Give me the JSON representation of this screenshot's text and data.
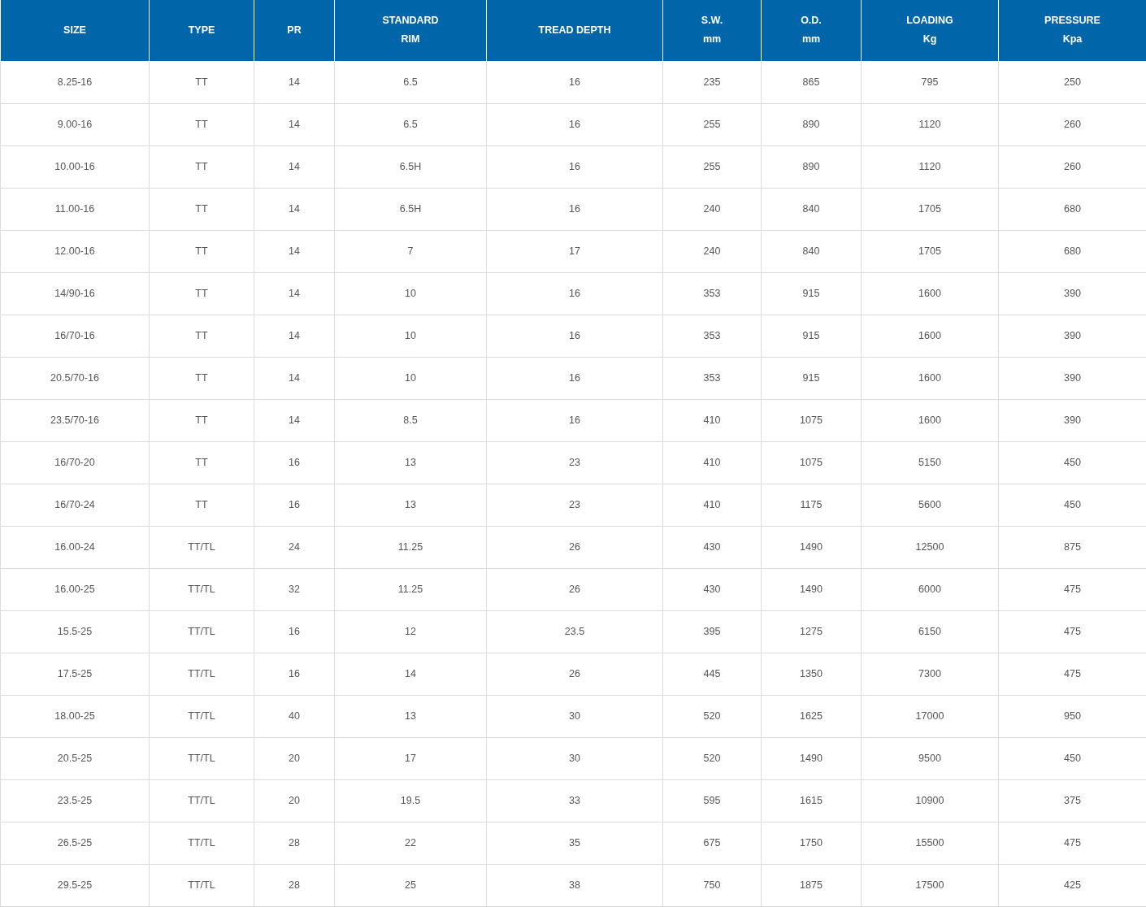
{
  "table": {
    "columns": [
      {
        "lines": [
          "SIZE"
        ]
      },
      {
        "lines": [
          "TYPE"
        ]
      },
      {
        "lines": [
          "PR"
        ]
      },
      {
        "lines": [
          "STANDARD",
          "RIM"
        ]
      },
      {
        "lines": [
          "TREAD DEPTH"
        ]
      },
      {
        "lines": [
          "S.W.",
          "mm"
        ]
      },
      {
        "lines": [
          "O.D.",
          "mm"
        ]
      },
      {
        "lines": [
          "LOADING",
          "Kg"
        ]
      },
      {
        "lines": [
          "PRESSURE",
          "Kpa"
        ]
      }
    ],
    "rows": [
      [
        "8.25-16",
        "TT",
        "14",
        "6.5",
        "16",
        "235",
        "865",
        "795",
        "250"
      ],
      [
        "9.00-16",
        "TT",
        "14",
        "6.5",
        "16",
        "255",
        "890",
        "1120",
        "260"
      ],
      [
        "10.00-16",
        "TT",
        "14",
        "6.5H",
        "16",
        "255",
        "890",
        "1120",
        "260"
      ],
      [
        "11.00-16",
        "TT",
        "14",
        "6.5H",
        "16",
        "240",
        "840",
        "1705",
        "680"
      ],
      [
        "12.00-16",
        "TT",
        "14",
        "7",
        "17",
        "240",
        "840",
        "1705",
        "680"
      ],
      [
        "14/90-16",
        "TT",
        "14",
        "10",
        "16",
        "353",
        "915",
        "1600",
        "390"
      ],
      [
        "16/70-16",
        "TT",
        "14",
        "10",
        "16",
        "353",
        "915",
        "1600",
        "390"
      ],
      [
        "20.5/70-16",
        "TT",
        "14",
        "10",
        "16",
        "353",
        "915",
        "1600",
        "390"
      ],
      [
        "23.5/70-16",
        "TT",
        "14",
        "8.5",
        "16",
        "410",
        "1075",
        "1600",
        "390"
      ],
      [
        "16/70-20",
        "TT",
        "16",
        "13",
        "23",
        "410",
        "1075",
        "5150",
        "450"
      ],
      [
        "16/70-24",
        "TT",
        "16",
        "13",
        "23",
        "410",
        "1175",
        "5600",
        "450"
      ],
      [
        "16.00-24",
        "TT/TL",
        "24",
        "11.25",
        "26",
        "430",
        "1490",
        "12500",
        "875"
      ],
      [
        "16.00-25",
        "TT/TL",
        "32",
        "11.25",
        "26",
        "430",
        "1490",
        "6000",
        "475"
      ],
      [
        "15.5-25",
        "TT/TL",
        "16",
        "12",
        "23.5",
        "395",
        "1275",
        "6150",
        "475"
      ],
      [
        "17.5-25",
        "TT/TL",
        "16",
        "14",
        "26",
        "445",
        "1350",
        "7300",
        "475"
      ],
      [
        "18.00-25",
        "TT/TL",
        "40",
        "13",
        "30",
        "520",
        "1625",
        "17000",
        "950"
      ],
      [
        "20.5-25",
        "TT/TL",
        "20",
        "17",
        "30",
        "520",
        "1490",
        "9500",
        "450"
      ],
      [
        "23.5-25",
        "TT/TL",
        "20",
        "19.5",
        "33",
        "595",
        "1615",
        "10900",
        "375"
      ],
      [
        "26.5-25",
        "TT/TL",
        "28",
        "22",
        "35",
        "675",
        "1750",
        "15500",
        "475"
      ],
      [
        "29.5-25",
        "TT/TL",
        "28",
        "25",
        "38",
        "750",
        "1875",
        "17500",
        "425"
      ]
    ]
  }
}
